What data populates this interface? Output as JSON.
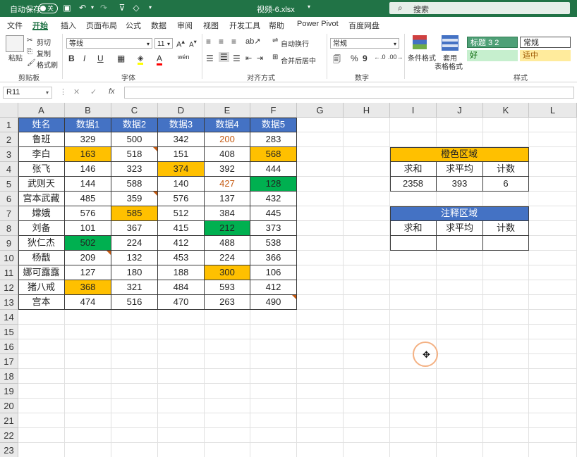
{
  "titlebar": {
    "autosave_label": "自动保存",
    "autosave_state": "关",
    "filename": "视频-6.xlsx",
    "search_placeholder": "搜索"
  },
  "menu": [
    "文件",
    "开始",
    "插入",
    "页面布局",
    "公式",
    "数据",
    "审阅",
    "视图",
    "开发工具",
    "帮助",
    "Power Pivot",
    "百度网盘"
  ],
  "ribbon": {
    "paste": "粘贴",
    "cut": "剪切",
    "copy": "复制",
    "format_painter": "格式刷",
    "clipboard_group": "剪贴板",
    "font_name": "等线",
    "font_size": "11",
    "font_group": "字体",
    "wrap_text": "自动换行",
    "merge_center": "合并后居中",
    "align_group": "对齐方式",
    "number_format": "常规",
    "number_group": "数字",
    "cond_format": "条件格式",
    "table_format_1": "套用",
    "table_format_2": "表格格式",
    "style_heading": "标题 3 2",
    "style_normal": "常规",
    "style_good": "好",
    "style_neutral": "适中",
    "styles_group": "样式"
  },
  "formula_bar": {
    "name_box": "R11",
    "formula": ""
  },
  "columns": [
    "A",
    "B",
    "C",
    "D",
    "E",
    "F",
    "G",
    "H",
    "I",
    "J",
    "K",
    "L"
  ],
  "rows": [
    "1",
    "2",
    "3",
    "4",
    "5",
    "6",
    "7",
    "8",
    "9",
    "10",
    "11",
    "12",
    "13",
    "14",
    "15",
    "16",
    "17",
    "18",
    "19",
    "20",
    "21",
    "22",
    "23"
  ],
  "data_table": {
    "headers": [
      "姓名",
      "数据1",
      "数据2",
      "数据3",
      "数据4",
      "数据5"
    ],
    "rows": [
      [
        "鲁班",
        "329",
        "500",
        "342",
        "200",
        "283"
      ],
      [
        "李白",
        "163",
        "518",
        "151",
        "408",
        "568"
      ],
      [
        "张飞",
        "146",
        "323",
        "374",
        "392",
        "444"
      ],
      [
        "武则天",
        "144",
        "588",
        "140",
        "427",
        "128"
      ],
      [
        "宫本武藏",
        "485",
        "359",
        "576",
        "137",
        "432"
      ],
      [
        "嫦娥",
        "576",
        "585",
        "512",
        "384",
        "445"
      ],
      [
        "刘备",
        "101",
        "367",
        "415",
        "212",
        "373"
      ],
      [
        "狄仁杰",
        "502",
        "224",
        "412",
        "488",
        "538"
      ],
      [
        "杨戬",
        "209",
        "132",
        "453",
        "224",
        "366"
      ],
      [
        "娜可露露",
        "127",
        "180",
        "188",
        "300",
        "106"
      ],
      [
        "猪八戒",
        "368",
        "321",
        "484",
        "593",
        "412"
      ],
      [
        "宫本",
        "474",
        "516",
        "470",
        "263",
        "490"
      ]
    ]
  },
  "orange_summary": {
    "title": "橙色区域",
    "headers": [
      "求和",
      "求平均",
      "计数"
    ],
    "values": [
      "2358",
      "393",
      "6"
    ]
  },
  "comment_summary": {
    "title": "注释区域",
    "headers": [
      "求和",
      "求平均",
      "计数"
    ],
    "values": [
      "",
      "",
      ""
    ]
  },
  "colors": {
    "header_blue": "#4472c4",
    "orange": "#ffc000",
    "green": "#00b050",
    "dark_red_text": "#c55a11",
    "excel_green": "#217346"
  }
}
